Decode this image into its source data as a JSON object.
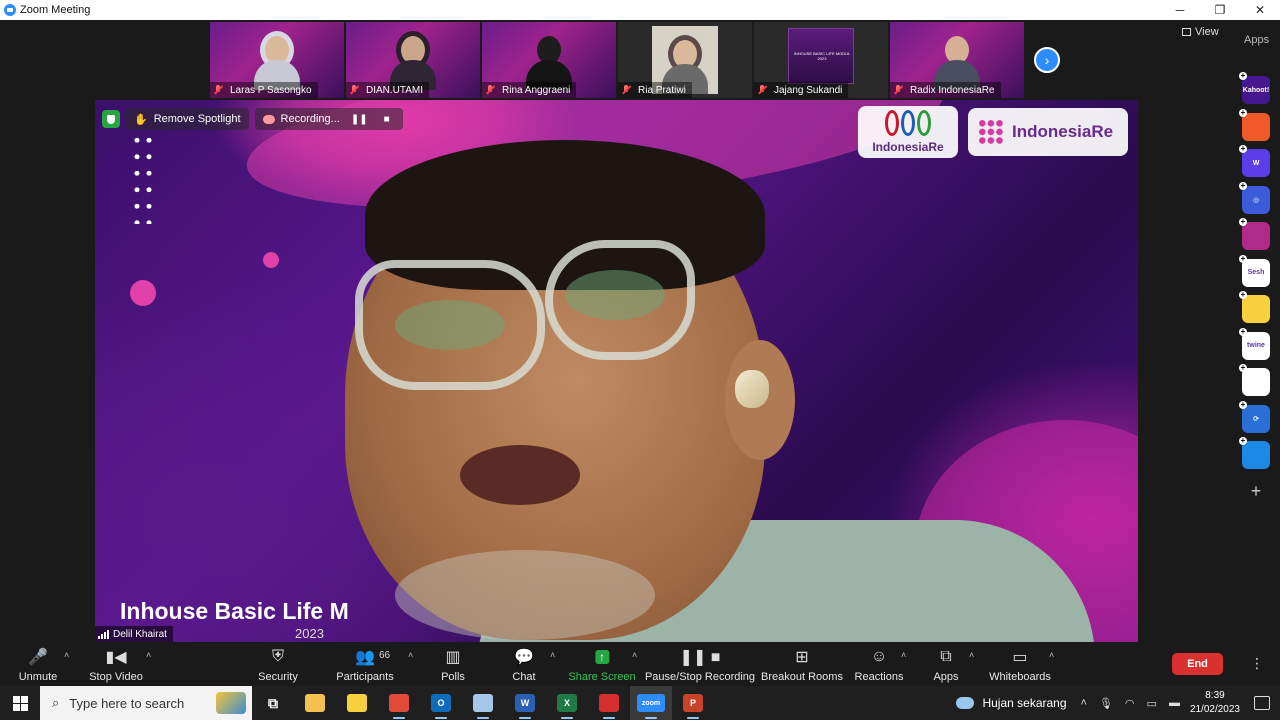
{
  "window": {
    "title": "Zoom Meeting",
    "controls": [
      "─",
      "❐",
      "✕"
    ]
  },
  "thumbnails": [
    {
      "name": "Laras P Sasongko",
      "style": "hijab-light"
    },
    {
      "name": "DIAN.UTAMI",
      "style": "hijab-dark"
    },
    {
      "name": "Rina Anggraeni",
      "style": "black"
    },
    {
      "name": "Ria Pratiwi",
      "style": "photo"
    },
    {
      "name": "Jajang Sukandi",
      "style": "slide",
      "slide_text": "INHOUSE BASIC LIFE MODUL 2023"
    },
    {
      "name": "Radix IndonesiaRe",
      "style": "bald"
    }
  ],
  "view_label": "View",
  "apps_panel": {
    "label": "Apps",
    "items": [
      {
        "name": "kahoot-app-icon",
        "text": "Kahoot!",
        "bg": "#46178f"
      },
      {
        "name": "slido-app-icon",
        "text": "",
        "bg": "#f05a28"
      },
      {
        "name": "wooclap-app-icon",
        "text": "W",
        "bg": "#5c3ee8"
      },
      {
        "name": "around-app-icon",
        "text": "◎",
        "bg": "#3b5bdb"
      },
      {
        "name": "mural-app-icon",
        "text": "",
        "bg": "#b02a8a"
      },
      {
        "name": "sesh-app-icon",
        "text": "Sesh",
        "bg": "#ffffff"
      },
      {
        "name": "emoji-app-icon",
        "text": "",
        "bg": "#f7d23e"
      },
      {
        "name": "twine-app-icon",
        "text": "twine",
        "bg": "#ffffff"
      },
      {
        "name": "puzzle-app-icon",
        "text": "",
        "bg": "#ffffff"
      },
      {
        "name": "sync-app-icon",
        "text": "⟳",
        "bg": "#2a6fd6"
      },
      {
        "name": "stack-app-icon",
        "text": "",
        "bg": "#1e88e5"
      }
    ]
  },
  "spotlight": {
    "remove_label": "Remove Spotlight",
    "recording_label": "Recording...",
    "pause_icon": "❚❚",
    "stop_icon": "■"
  },
  "logos": {
    "left": "IndonesiaRe",
    "right": "IndonesiaRe"
  },
  "slide": {
    "title": "Inhouse Basic Life M",
    "year": "2023"
  },
  "speaker_name": "Delil Khairat",
  "toolbar": {
    "items": [
      {
        "key": "unmute",
        "label": "Unmute",
        "icon": "🎤"
      },
      {
        "key": "stop-video",
        "label": "Stop Video",
        "icon": "▮◀"
      },
      {
        "key": "security",
        "label": "Security",
        "icon": "⛨"
      },
      {
        "key": "participants",
        "label": "Participants",
        "icon": "👥"
      },
      {
        "key": "polls",
        "label": "Polls",
        "icon": "▥"
      },
      {
        "key": "chat",
        "label": "Chat",
        "icon": "💬"
      },
      {
        "key": "share-screen",
        "label": "Share Screen",
        "icon": "↑"
      },
      {
        "key": "pause-stop-recording",
        "label": "Pause/Stop Recording",
        "icon": "❚❚ ■"
      },
      {
        "key": "breakout-rooms",
        "label": "Breakout Rooms",
        "icon": "⊞"
      },
      {
        "key": "reactions",
        "label": "Reactions",
        "icon": "☺"
      },
      {
        "key": "apps",
        "label": "Apps",
        "icon": "⧉"
      },
      {
        "key": "whiteboards",
        "label": "Whiteboards",
        "icon": "▭"
      }
    ],
    "participants_count": "66",
    "end_label": "End",
    "more_icon": "⋮"
  },
  "taskbar": {
    "search_placeholder": "Type here to search",
    "apps": [
      {
        "name": "task-view-icon",
        "text": "⧉",
        "bg": "transparent"
      },
      {
        "name": "file-explorer-icon",
        "text": "",
        "bg": "#f2c14e"
      },
      {
        "name": "sticky-notes-icon",
        "text": "",
        "bg": "#f7d23e"
      },
      {
        "name": "chrome-icon",
        "text": "",
        "bg": "#e04a3a"
      },
      {
        "name": "outlook-icon",
        "text": "O",
        "bg": "#0f6cbd"
      },
      {
        "name": "paint-icon",
        "text": "",
        "bg": "#a6c7e8"
      },
      {
        "name": "word-icon",
        "text": "W",
        "bg": "#2b5fb4"
      },
      {
        "name": "excel-icon",
        "text": "X",
        "bg": "#1f7a43"
      },
      {
        "name": "acrobat-icon",
        "text": "",
        "bg": "#d32f2f"
      },
      {
        "name": "zoom-icon",
        "text": "zoom",
        "bg": "#2d8cff"
      },
      {
        "name": "powerpoint-icon",
        "text": "P",
        "bg": "#c9432b"
      }
    ],
    "weather": "Hujan sekarang",
    "time": "8:39",
    "date": "21/02/2023"
  }
}
